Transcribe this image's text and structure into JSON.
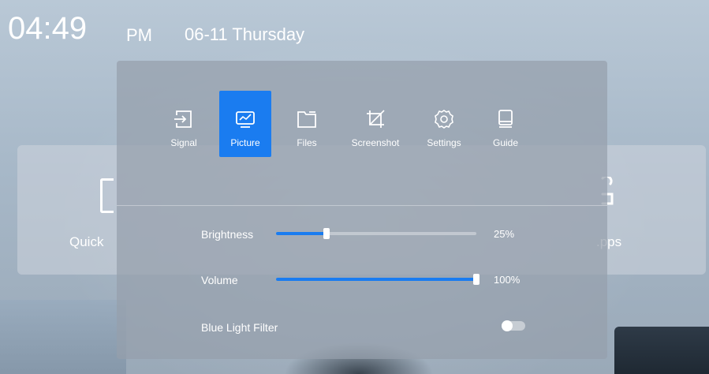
{
  "status": {
    "time": "04:49",
    "ampm": "PM",
    "date": "06-11 Thursday"
  },
  "launcher": {
    "left_label": "Quick",
    "right_label": ".pps"
  },
  "tabs": [
    {
      "label": "Signal",
      "icon": "signal-input-icon",
      "active": false
    },
    {
      "label": "Picture",
      "icon": "picture-icon",
      "active": true
    },
    {
      "label": "Files",
      "icon": "folder-icon",
      "active": false
    },
    {
      "label": "Screenshot",
      "icon": "screenshot-icon",
      "active": false
    },
    {
      "label": "Settings",
      "icon": "gear-icon",
      "active": false
    },
    {
      "label": "Guide",
      "icon": "guide-icon",
      "active": false
    }
  ],
  "controls": {
    "brightness": {
      "label": "Brightness",
      "value": 25,
      "display": "25%"
    },
    "volume": {
      "label": "Volume",
      "value": 100,
      "display": "100%"
    },
    "blue_light": {
      "label": "Blue Light Filter",
      "enabled": false
    }
  },
  "colors": {
    "accent": "#1a7cf0"
  }
}
